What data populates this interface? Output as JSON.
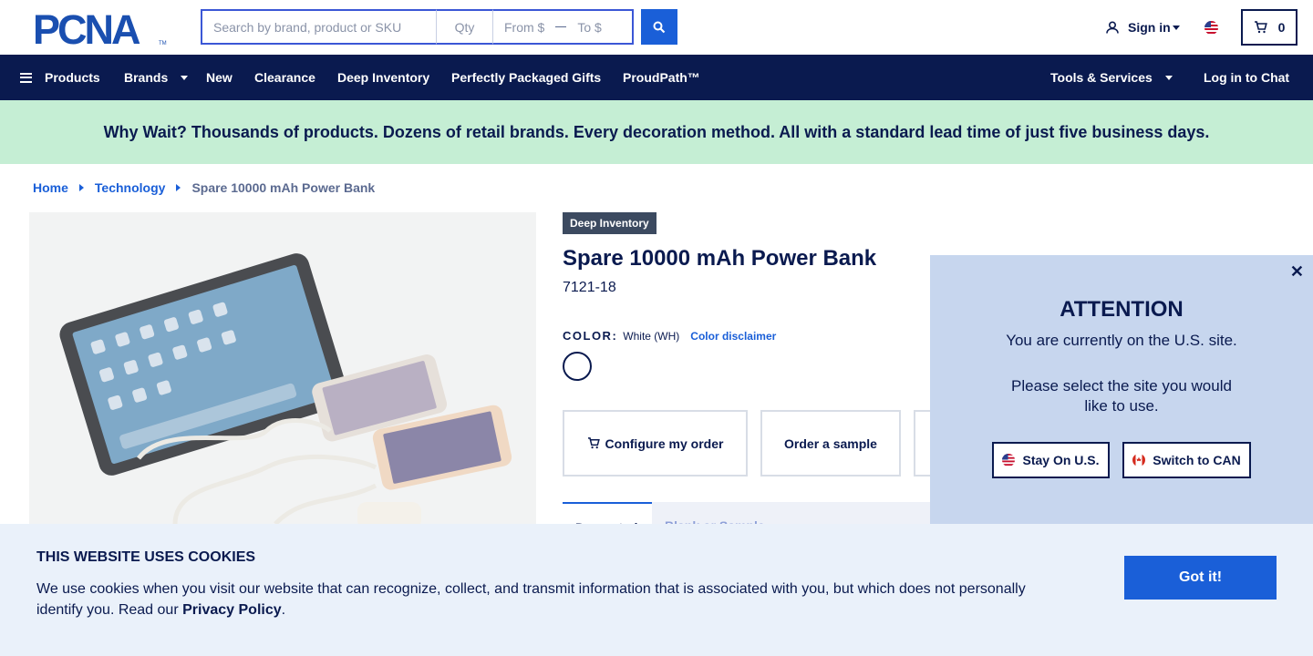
{
  "header": {
    "logo_text": "PCNA",
    "search": {
      "placeholder": "Search by brand, product or SKU",
      "qty_placeholder": "Qty",
      "from_placeholder": "From $",
      "to_placeholder": "To $"
    },
    "sign_in": "Sign in",
    "cart_count": "0"
  },
  "nav": {
    "products": "Products",
    "brands": "Brands",
    "new": "New",
    "clearance": "Clearance",
    "deep_inventory": "Deep Inventory",
    "gifts": "Perfectly Packaged Gifts",
    "proudpath": "ProudPath™",
    "tools": "Tools & Services",
    "chat": "Log in to Chat"
  },
  "promo": "Why Wait? Thousands of products. Dozens of retail brands. Every decoration method. All with a standard lead time of just five business days.",
  "breadcrumb": {
    "home": "Home",
    "category": "Technology",
    "current": "Spare 10000 mAh Power Bank"
  },
  "product": {
    "badge": "Deep Inventory",
    "title": "Spare 10000 mAh Power Bank",
    "sku": "7121-18",
    "color_label": "COLOR:",
    "color_value": "White (WH)",
    "color_disclaimer": "Color disclaimer",
    "configure_label": "Configure my order",
    "sample_label": "Order a sample",
    "tab1": "Decorated",
    "tab2": "Blank or Sample"
  },
  "modal": {
    "title": "ATTENTION",
    "message1": "You are currently on the U.S. site.",
    "message2": "Please select the site you would like to use.",
    "stay_label": "Stay On U.S.",
    "switch_label": "Switch to CAN"
  },
  "cookie": {
    "title": "THIS WEBSITE USES COOKIES",
    "text": "We use cookies when you visit our website that can recognize, collect, and transmit information that is associated with you, but which does not personally identify you. Read our",
    "link": "Privacy Policy",
    "period": ".",
    "button": "Got it!"
  },
  "colors": {
    "navy": "#0a1a4f",
    "accent_blue": "#1a5fd8",
    "promo_green": "#c5eed4",
    "modal_bg": "#c7d6ee",
    "cookie_bg": "#eaf1fa"
  },
  "icons": [
    "search-icon",
    "user-icon",
    "us-flag-icon",
    "cart-icon",
    "menu-icon",
    "close-icon",
    "canada-flag-icon"
  ]
}
